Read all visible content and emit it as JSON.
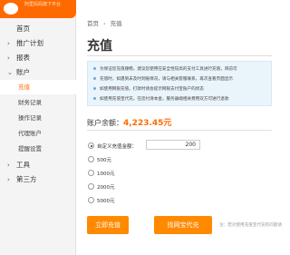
{
  "logo": {
    "tagline": "阿里妈妈旗下平台"
  },
  "sidebar": {
    "items": [
      {
        "label": "首页",
        "arrow": ""
      },
      {
        "label": "推广计划",
        "arrow": "›"
      },
      {
        "label": "报表",
        "arrow": "›"
      },
      {
        "label": "账户",
        "arrow": "⌄"
      }
    ],
    "account_sub": [
      "充值",
      "财务记录",
      "操作记录",
      "代理账户",
      "提醒设置"
    ],
    "items_after": [
      {
        "label": "工具",
        "arrow": "›"
      },
      {
        "label": "第三方",
        "arrow": "›"
      }
    ]
  },
  "breadcrumb": {
    "home": "首页",
    "sep": "›",
    "current": "充值"
  },
  "page_title": "充值",
  "notices": [
    "为保证您充值顺畅，建议您使用在安全性较高的支付工具进行充值，目前可",
    "充值时，如遇到未及时到账情况，请与相关客服联系，再次查看页面显示",
    "如使用网银充值，打款时请会提示网银支付宝账户的状态",
    "如使用充值宝代充，在您付清本金，服务器端相关费用双方可进行退款"
  ],
  "balance": {
    "label": "账户余额：",
    "amount": "4,223.45元"
  },
  "options": [
    {
      "label": "自定义充值金额：",
      "checked": true
    },
    {
      "label": "500元",
      "checked": false
    },
    {
      "label": "1000元",
      "checked": false
    },
    {
      "label": "2000元",
      "checked": false
    },
    {
      "label": "5000元",
      "checked": false
    }
  ],
  "custom_amount": "200",
  "buttons": {
    "recharge": "立即充值",
    "agent": "找网宝代充"
  },
  "hint": "注：若对使用充值宝代充有问题请"
}
